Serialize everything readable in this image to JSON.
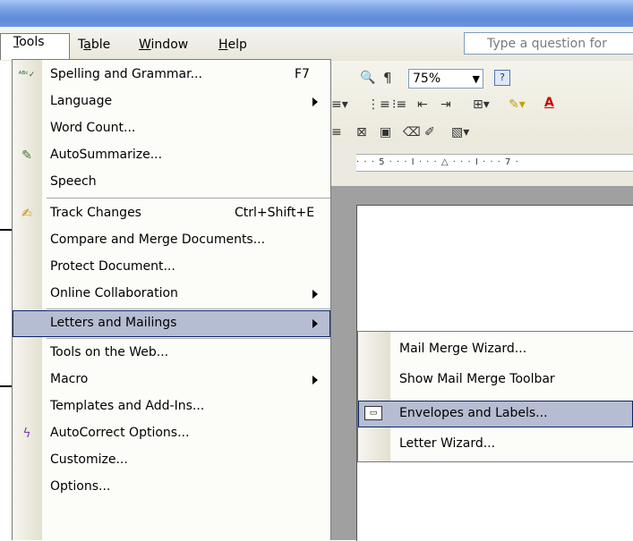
{
  "menubar": {
    "items": [
      "Tools",
      "Table",
      "Window",
      "Help"
    ],
    "question_placeholder": "Type a question for"
  },
  "toolbar": {
    "zoom": "75%",
    "ruler_text": "· · · 5 · · · I · · · △ · · · I · · · 7 ·"
  },
  "tools_menu": {
    "items": [
      {
        "label": "Spelling and Grammar...",
        "shortcut": "F7",
        "icon": "spelling-icon"
      },
      {
        "label": "Language",
        "submenu": true
      },
      {
        "label": "Word Count..."
      },
      {
        "label": "AutoSummarize...",
        "icon": "autosummarize-icon"
      },
      {
        "label": "Speech"
      },
      {
        "label": "Track Changes",
        "shortcut": "Ctrl+Shift+E",
        "icon": "track-changes-icon"
      },
      {
        "label": "Compare and Merge Documents..."
      },
      {
        "label": "Protect Document..."
      },
      {
        "label": "Online Collaboration",
        "submenu": true
      },
      {
        "label": "Letters and Mailings",
        "submenu": true,
        "highlighted": true
      },
      {
        "label": "Tools on the Web..."
      },
      {
        "label": "Macro",
        "submenu": true
      },
      {
        "label": "Templates and Add-Ins..."
      },
      {
        "label": "AutoCorrect Options...",
        "icon": "autocorrect-icon"
      },
      {
        "label": "Customize..."
      },
      {
        "label": "Options..."
      }
    ]
  },
  "letters_submenu": {
    "items": [
      {
        "label": "Mail Merge Wizard..."
      },
      {
        "label": "Show Mail Merge Toolbar"
      },
      {
        "label": "Envelopes and Labels...",
        "highlighted": true,
        "icon": "envelope-icon"
      },
      {
        "label": "Letter Wizard..."
      }
    ]
  },
  "colors": {
    "highlight": "#b6bdd2",
    "highlight_border": "#0a246a",
    "titlebar": "#6b95e0"
  }
}
